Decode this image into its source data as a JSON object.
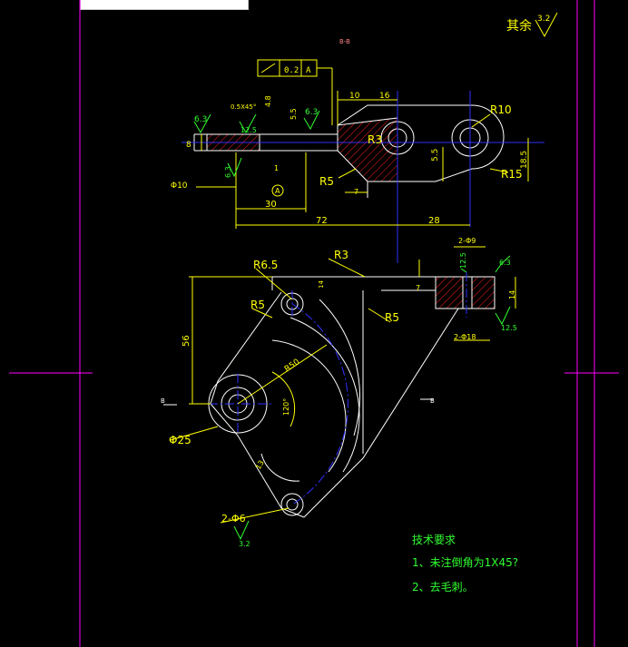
{
  "colors": {
    "background": "#000000",
    "outline": "#ffffff",
    "dimension": "#ffff00",
    "center": "#3030ff",
    "border": "#ff00ff",
    "note": "#30ff30",
    "hatch": "#ff2020"
  },
  "roughness_note": {
    "label": "其余",
    "value": "3.2"
  },
  "section_label": "B-B",
  "tolerance_frame": {
    "value": "0.2",
    "datum": "A"
  },
  "datum_marker": "A",
  "top_view": {
    "chamfer": "0.5X45°",
    "dim_top_a": "4.8",
    "dim_top_b": "5.5",
    "roughness_left": "6.3",
    "roughness_mid": "6.3",
    "roughness_small": "12.5",
    "roughness_bottom": "6.3",
    "dim_10": "10",
    "dim_16": "16",
    "r10": "R10",
    "r3": "R3",
    "r5": "R5",
    "r15": "R15",
    "dim_5_5": "5.5",
    "dim_18_5": "18.5",
    "dim_8": "8",
    "dim_1": "1",
    "dim_7": "7",
    "hole": "Φ10",
    "dim_30": "30",
    "dim_72": "72",
    "dim_28": "28"
  },
  "front_view": {
    "r6_5": "R6.5",
    "r3": "R3",
    "r5_left": "R5",
    "r5_right": "R5",
    "dim_56": "56",
    "r50": "R50",
    "angle": "120°",
    "dim_13": "13",
    "hole_25": "Φ25",
    "holes_6": "2-Φ6",
    "holes_9": "2-Φ9",
    "holes_18": "2-Φ18",
    "dim_14": "14",
    "dim_7": "7",
    "dim_14_small": "14",
    "rough_12_5_a": "12.5",
    "rough_6_3": "6.3",
    "rough_12_5_b": "12.5",
    "rough_3_2": "3.2",
    "section_mark": "B"
  },
  "tech_notes": {
    "title": "技术要求",
    "items": [
      "1、未注倒角为1X45?",
      "2、去毛刺。"
    ]
  }
}
